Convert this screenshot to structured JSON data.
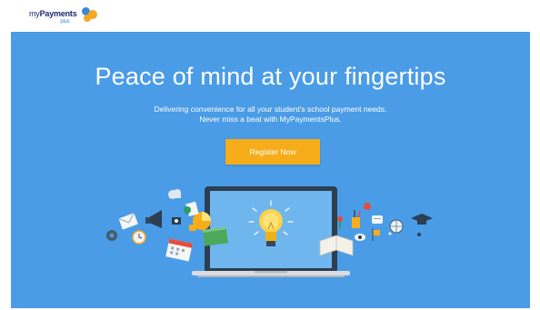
{
  "header": {
    "logo": {
      "prefix": "my",
      "name": "Payments",
      "suffix": "plus",
      "colors": {
        "blue": "#3b8ad6",
        "orange": "#f5a623",
        "navy": "#1a2a6c"
      }
    }
  },
  "hero": {
    "background": "#4a9ce6",
    "headline": "Peace of mind at your fingertips",
    "subtext": "Delivering convenience for all your student's school payment needs. Never miss a beat with MyPaymentsPlus.",
    "cta_label": "Register Now",
    "cta_color": "#f7ad1a"
  }
}
